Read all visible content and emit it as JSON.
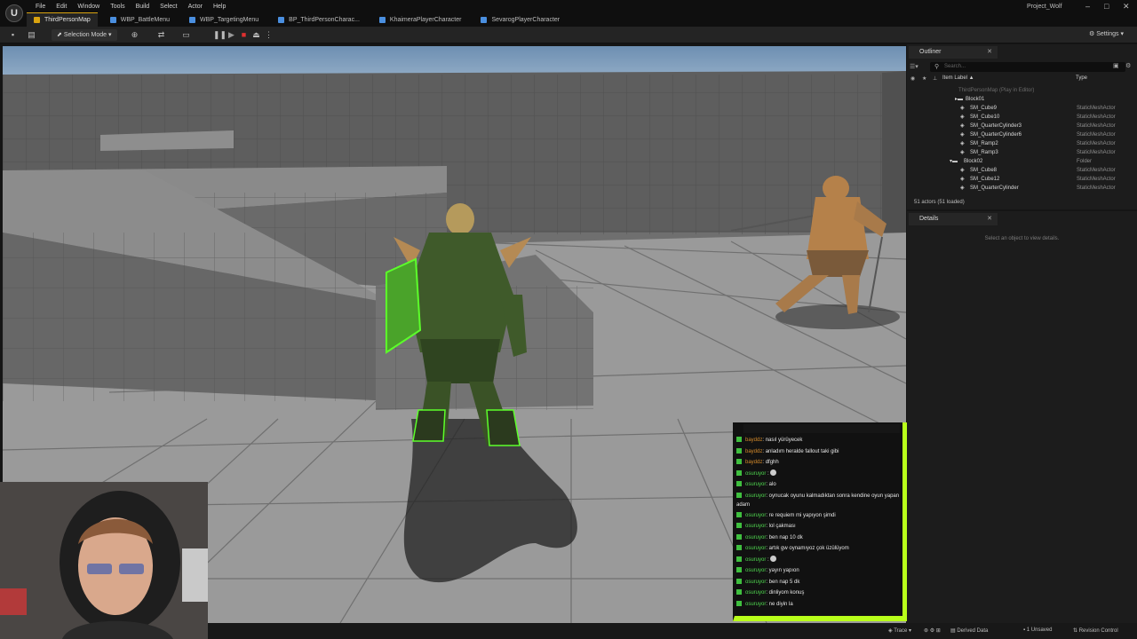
{
  "menu": [
    "File",
    "Edit",
    "Window",
    "Tools",
    "Build",
    "Select",
    "Actor",
    "Help"
  ],
  "project_name": "Project_Wolf",
  "tabs": [
    {
      "label": "ThirdPersonMap",
      "active": true,
      "icon_color": "#d9a30f"
    },
    {
      "label": "WBP_BattleMenu",
      "active": false,
      "icon_color": "#4a8fe0"
    },
    {
      "label": "WBP_TargetingMenu",
      "active": false,
      "icon_color": "#4a8fe0"
    },
    {
      "label": "BP_ThirdPersonCharac...",
      "active": false,
      "icon_color": "#4a8fe0"
    },
    {
      "label": "KhaimeraPlayerCharacter",
      "active": false,
      "icon_color": "#4a8fe0"
    },
    {
      "label": "SevarogPlayerCharacter",
      "active": false,
      "icon_color": "#4a8fe0"
    }
  ],
  "toolbar": {
    "selection_mode": "Selection Mode",
    "settings": "Settings"
  },
  "outliner": {
    "title": "Outliner",
    "search_placeholder": "Search...",
    "col_label": "Item Label ▲",
    "col_type": "Type",
    "rows": [
      {
        "label": "ThirdPersonMap (Play in Editor)",
        "type": "",
        "depth": 0,
        "dim": true
      },
      {
        "label": "Block01",
        "type": "",
        "depth": 1,
        "folder": true
      },
      {
        "label": "SM_Cube9",
        "type": "StaticMeshActor",
        "depth": 2
      },
      {
        "label": "SM_Cube10",
        "type": "StaticMeshActor",
        "depth": 2
      },
      {
        "label": "SM_QuarterCylinder3",
        "type": "StaticMeshActor",
        "depth": 2
      },
      {
        "label": "SM_QuarterCylinder6",
        "type": "StaticMeshActor",
        "depth": 2
      },
      {
        "label": "SM_Ramp2",
        "type": "StaticMeshActor",
        "depth": 2
      },
      {
        "label": "SM_Ramp3",
        "type": "StaticMeshActor",
        "depth": 2
      },
      {
        "label": "Block02",
        "type": "Folder",
        "depth": 1,
        "folder": true
      },
      {
        "label": "SM_Cube8",
        "type": "StaticMeshActor",
        "depth": 2
      },
      {
        "label": "SM_Cube12",
        "type": "StaticMeshActor",
        "depth": 2
      },
      {
        "label": "SM_QuarterCylinder",
        "type": "StaticMeshActor",
        "depth": 2
      }
    ],
    "actor_count": "51 actors (51 loaded)"
  },
  "details": {
    "title": "Details",
    "empty": "Select an object to view details."
  },
  "statusbar": {
    "trace": "Trace",
    "derived_data": "Derived Data",
    "unsaved": "1 Unsaved",
    "revision_control": "Revision Control"
  },
  "chat": {
    "lines": [
      {
        "user": "bayddz",
        "msg": ": nasıl yürüyecek",
        "orange": true
      },
      {
        "user": "bayddz",
        "msg": ": anladım heralde fallout taki gibi",
        "orange": true
      },
      {
        "user": "bayddz",
        "msg": ": dfghh",
        "orange": true
      },
      {
        "user": "osuruyor",
        "msg": " :",
        "emote": true
      },
      {
        "user": "osuruyor",
        "msg": ": alo"
      },
      {
        "user": "osuruyor",
        "msg": ": oynucak oyunu kalmadıktan sonra kendine oyun yapan adam",
        "wrap": true
      },
      {
        "user": "osuruyor",
        "msg": ": re requiem mi yapıyon şimdi"
      },
      {
        "user": "osuruyor",
        "msg": ": lol çakması"
      },
      {
        "user": "osuruyor",
        "msg": ": ben nap 10 dk"
      },
      {
        "user": "osuruyor",
        "msg": ": artık gw oynamıyoz çok üzülüyom"
      },
      {
        "user": "osuruyor",
        "msg": " :",
        "emote": true
      },
      {
        "user": "osuruyor",
        "msg": ": yayın yapıon"
      },
      {
        "user": "osuruyor",
        "msg": ": ben nap 5 dk"
      },
      {
        "user": "osuruyor",
        "msg": ": dinliyom konuş"
      },
      {
        "user": "osuruyor",
        "msg": ": ne diyin la"
      }
    ]
  },
  "colors": {
    "chat_border": "#b8ff1a",
    "accent": "#d9a30f",
    "armor_glow": "#5cff2a"
  }
}
